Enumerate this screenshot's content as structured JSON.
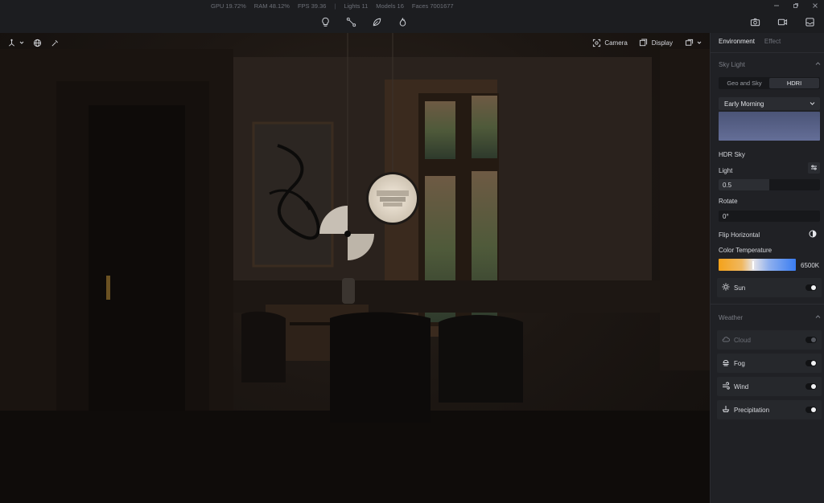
{
  "stats": {
    "gpu": "GPU 19.72%",
    "ram": "RAM 48.12%",
    "fps": "FPS 39.36",
    "separator": "|",
    "lights": "Lights 11",
    "models": "Models 16",
    "faces": "Faces 7001677"
  },
  "toolbar": {
    "tools": [
      "light-bulb-icon",
      "path-nodes-icon",
      "leaf-icon",
      "flame-icon"
    ],
    "right_tools": [
      "camera-icon",
      "video-icon",
      "layers-icon"
    ]
  },
  "viewport": {
    "camera_label": "Camera",
    "display_label": "Display"
  },
  "panel": {
    "tabs": {
      "environment": "Environment",
      "effect": "Effect"
    },
    "sky_light": {
      "title": "Sky Light",
      "mode_geo": "Geo and Sky",
      "mode_hdri": "HDRI",
      "preset": "Early Morning",
      "hdr_sky": "HDR Sky",
      "light_label": "Light",
      "light_value": "0.5",
      "light_fraction": 0.5,
      "rotate_label": "Rotate",
      "rotate_value": "0°",
      "flip_label": "Flip Horizontal",
      "color_temp_label": "Color Temperature",
      "color_temp_value": "6500K",
      "sun_label": "Sun"
    },
    "weather": {
      "title": "Weather",
      "cloud": "Cloud",
      "fog": "Fog",
      "wind": "Wind",
      "precipitation": "Precipitation"
    }
  },
  "colors": {
    "panel_bg": "#202125",
    "accent_warm": "#f4a21a",
    "accent_cool": "#3a7df2",
    "preview_sky": "#5a6389"
  }
}
